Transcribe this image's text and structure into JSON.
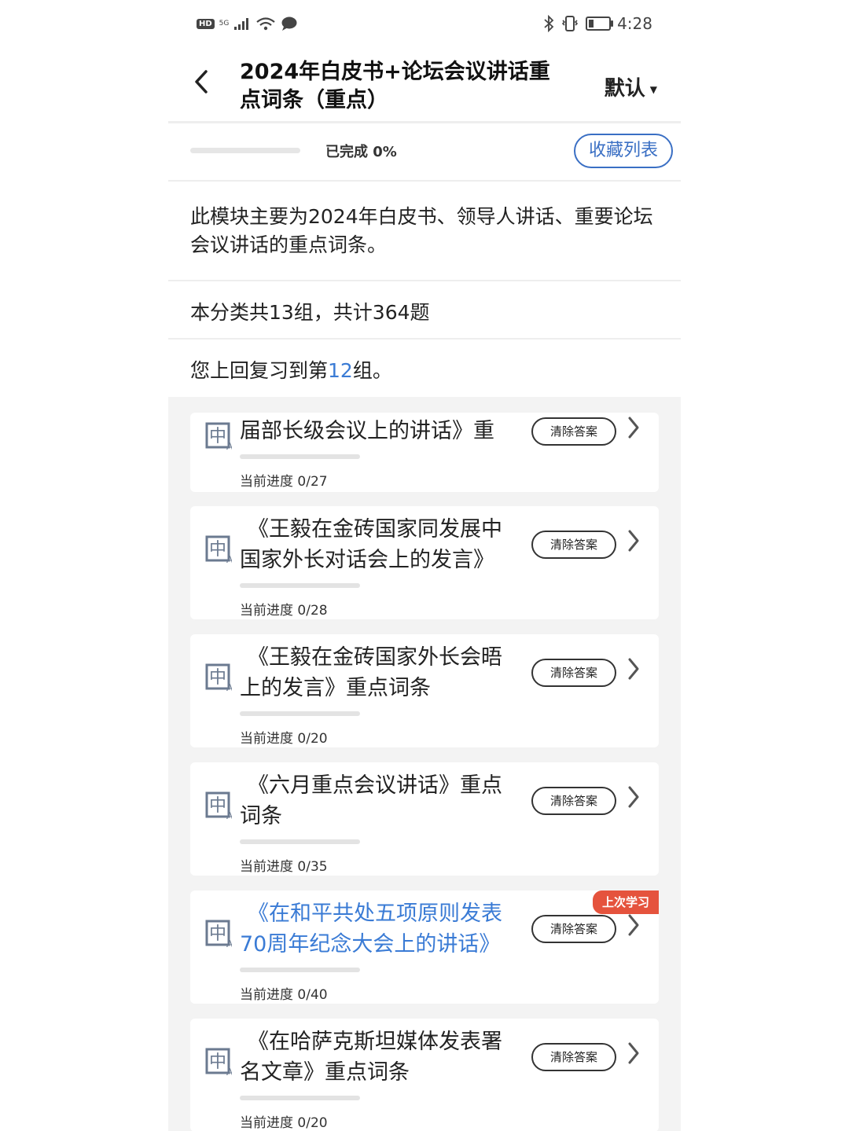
{
  "status_bar": {
    "hd": "HD",
    "net": "5G",
    "time": "4:28",
    "icons": [
      "signal-icon",
      "wifi-icon",
      "message-icon",
      "bluetooth-icon",
      "vibrate-icon",
      "battery-icon"
    ]
  },
  "header": {
    "title": "2024年白皮书+论坛会议讲话重点词条（重点）",
    "sort_label": "默认"
  },
  "progress": {
    "completed_label": "已完成 0%",
    "fraction": 0,
    "favorites_button": "收藏列表"
  },
  "info": {
    "description": "此模块主要为2024年白皮书、领导人讲话、重要论坛会议讲话的重点词条。",
    "summary": "本分类共13组，共计364题",
    "last_prefix": "您上回复习到第",
    "last_group": "12",
    "last_suffix": "组。"
  },
  "colors": {
    "accent": "#3a7bd5",
    "badge": "#e5533d"
  },
  "cards": [
    {
      "title": "届部长级会议上的讲话》重",
      "progress_label": "当前进度 0/27",
      "done": 0,
      "total": 27,
      "clear": "清除答案",
      "active": false,
      "badge": ""
    },
    {
      "title": "《王毅在金砖国家同发展中国家外长对话会上的发言》",
      "progress_label": "当前进度 0/28",
      "done": 0,
      "total": 28,
      "clear": "清除答案",
      "active": false,
      "badge": ""
    },
    {
      "title": "《王毅在金砖国家外长会晤上的发言》重点词条",
      "progress_label": "当前进度 0/20",
      "done": 0,
      "total": 20,
      "clear": "清除答案",
      "active": false,
      "badge": ""
    },
    {
      "title": "《六月重点会议讲话》重点词条",
      "progress_label": "当前进度 0/35",
      "done": 0,
      "total": 35,
      "clear": "清除答案",
      "active": false,
      "badge": ""
    },
    {
      "title": "《在和平共处五项原则发表70周年纪念大会上的讲话》",
      "progress_label": "当前进度 0/40",
      "done": 0,
      "total": 40,
      "clear": "清除答案",
      "active": true,
      "badge": "上次学习"
    },
    {
      "title": "《在哈萨克斯坦媒体发表署名文章》重点词条",
      "progress_label": "当前进度 0/20",
      "done": 0,
      "total": 20,
      "clear": "清除答案",
      "active": false,
      "badge": ""
    }
  ]
}
